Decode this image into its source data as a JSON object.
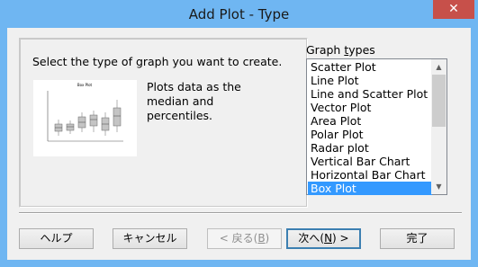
{
  "window": {
    "title": "Add Plot - Type",
    "close_glyph": "✕"
  },
  "instruction": "Select the type of graph you want to create.",
  "preview": {
    "description": "Plots data as the median and percentiles.",
    "thumbnail_title": "Box Plot",
    "thumbnail_icon": "box-plot-thumbnail"
  },
  "graph_types": {
    "label": "Graph types",
    "label_mnemonic_char": "t",
    "items": [
      "Scatter Plot",
      "Line Plot",
      "Line and Scatter Plot",
      "Vector Plot",
      "Area Plot",
      "Polar Plot",
      "Radar plot",
      "Vertical Bar Chart",
      "Horizontal Bar Chart",
      "Box Plot"
    ],
    "selected": "Box Plot"
  },
  "buttons": {
    "help": "ヘルプ",
    "cancel": "キャンセル",
    "back": "< 戻る(B)",
    "next": "次へ(N) >",
    "finish": "完了"
  },
  "colors": {
    "selection": "#3399ff",
    "title_bar": "#6fb6f2",
    "close_button": "#c7504a"
  }
}
